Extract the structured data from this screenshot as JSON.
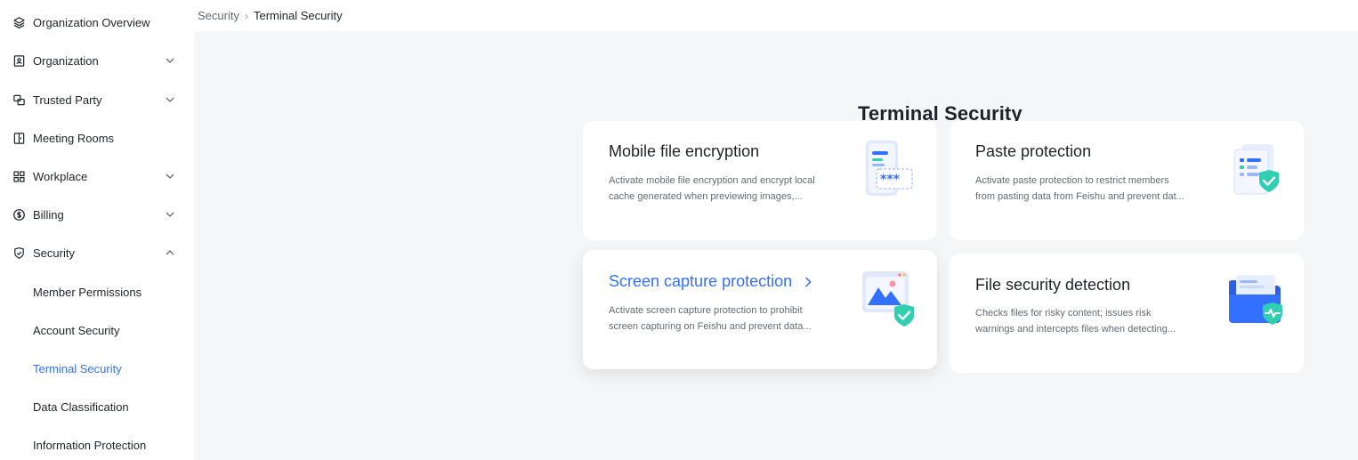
{
  "sidebar": {
    "items": [
      {
        "label": "Organization Overview",
        "icon": "layers-icon",
        "expandable": false
      },
      {
        "label": "Organization",
        "icon": "contact-card-icon",
        "expandable": true
      },
      {
        "label": "Trusted Party",
        "icon": "linked-squares-icon",
        "expandable": true
      },
      {
        "label": "Meeting Rooms",
        "icon": "door-icon",
        "expandable": false
      },
      {
        "label": "Workplace",
        "icon": "grid-icon",
        "expandable": true
      },
      {
        "label": "Billing",
        "icon": "dollar-circle-icon",
        "expandable": true
      },
      {
        "label": "Security",
        "icon": "shield-icon",
        "expandable": true,
        "expanded": true
      }
    ],
    "security_sub": [
      {
        "label": "Member Permissions"
      },
      {
        "label": "Account Security"
      },
      {
        "label": "Terminal Security",
        "active": true
      },
      {
        "label": "Data Classification"
      },
      {
        "label": "Information Protection"
      }
    ]
  },
  "breadcrumb": {
    "parent": "Security",
    "current": "Terminal Security"
  },
  "page": {
    "title": "Terminal Security"
  },
  "cards": [
    {
      "title": "Mobile file encryption",
      "desc_line1": "Activate mobile file encryption and encrypt local",
      "desc_line2": "cache generated when previewing images,...",
      "icon": "encrypted-phone-icon"
    },
    {
      "title": "Paste protection",
      "desc_line1": "Activate paste protection to restrict members",
      "desc_line2": "from pasting data from Feishu and prevent dat...",
      "icon": "protected-document-icon"
    },
    {
      "title": "Screen capture protection",
      "desc_line1": "Activate screen capture protection to prohibit",
      "desc_line2": "screen capturing on Feishu and prevent data...",
      "icon": "protected-image-icon",
      "hovered": true
    },
    {
      "title": "File security detection",
      "desc_line1": "Checks files for risky content; issues risk",
      "desc_line2": "warnings and intercepts files when detecting...",
      "icon": "folder-health-icon"
    }
  ],
  "colors": {
    "accent": "#3370ff",
    "teal": "#2fcfb0",
    "text": "#1f2329",
    "muted": "#646a73",
    "background": "#f5f6f7"
  }
}
